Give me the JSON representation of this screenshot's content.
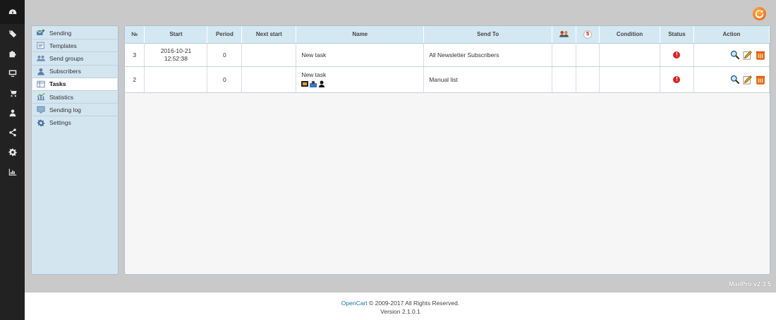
{
  "rail": {
    "icons": [
      "dashboard-icon",
      "tags-icon",
      "puzzle-icon",
      "monitor-icon",
      "cart-icon",
      "user-icon",
      "share-icon",
      "gear-icon",
      "bar-chart-icon"
    ]
  },
  "submenu": {
    "items": [
      {
        "label": "Sending",
        "icon": "sending-icon"
      },
      {
        "label": "Templates",
        "icon": "templates-icon"
      },
      {
        "label": "Send groups",
        "icon": "send-groups-icon"
      },
      {
        "label": "Subscribers",
        "icon": "subscribers-icon"
      },
      {
        "label": "Tasks",
        "icon": "tasks-icon",
        "active": true
      },
      {
        "label": "Statistics",
        "icon": "statistics-icon"
      },
      {
        "label": "Sending log",
        "icon": "sending-log-icon"
      },
      {
        "label": "Settings",
        "icon": "settings-icon"
      }
    ]
  },
  "table": {
    "headers": {
      "num": "№",
      "start": "Start",
      "period": "Period",
      "next_start": "Next start",
      "name": "Name",
      "send_to": "Send To",
      "dollar": "$",
      "condition": "Condition",
      "status": "Status",
      "action": "Action"
    },
    "rows": [
      {
        "num": "3",
        "start_date": "2016-10-21",
        "start_time": "12:52:38",
        "period": "0",
        "next_start": "",
        "name": "New task",
        "send_to": "All Newsletter Subscribers",
        "status": "!"
      },
      {
        "num": "2",
        "start_date": "",
        "start_time": "",
        "period": "0",
        "next_start": "",
        "name": "New task",
        "send_to": "Manual list",
        "status": "!"
      }
    ]
  },
  "version_tag": "MailPro v2.3.5",
  "footer": {
    "link": "OpenCart",
    "copyright": " © 2009-2017 All Rights Reserved.",
    "version": "Version 2.1.0.1"
  },
  "colors": {
    "rail": "#222222",
    "content_bg": "#c9c9c9",
    "menu_bg": "#d3e6f0",
    "header_bg": "#d4e8f2",
    "status_error": "#dd2222",
    "link": "#1e6fa8"
  }
}
